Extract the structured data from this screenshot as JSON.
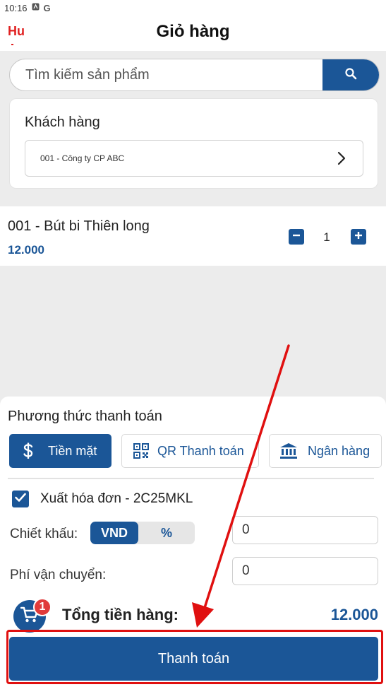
{
  "status_bar": {
    "time": "10:16",
    "icons": [
      "a-icon",
      "google-icon"
    ]
  },
  "header": {
    "back_label": "Hu",
    "title": "Giỏ hàng"
  },
  "search": {
    "placeholder": "Tìm kiếm sản phẩm",
    "icon": "search-icon"
  },
  "customer": {
    "label": "Khách hàng",
    "value": "001 - Công ty CP ABC"
  },
  "cart_items": [
    {
      "name": "001 - Bút bi Thiên long",
      "price": "12.000",
      "quantity": "1"
    }
  ],
  "payment": {
    "title": "Phương thức thanh toán",
    "methods": [
      {
        "label": "Tiền mặt",
        "icon": "dollar-icon",
        "active": true
      },
      {
        "label": "QR Thanh toán",
        "icon": "qr-code-icon",
        "active": false
      },
      {
        "label": "Ngân hàng",
        "icon": "bank-icon",
        "active": false
      }
    ]
  },
  "invoice": {
    "checked": true,
    "label": "Xuất hóa đơn - 2C25MKL"
  },
  "discount": {
    "label": "Chiết khấu:",
    "options": [
      "VND",
      "%"
    ],
    "selected": "VND",
    "value": "0"
  },
  "shipping": {
    "label": "Phí vận chuyển:",
    "value": "0"
  },
  "summary": {
    "cart_count": "1",
    "total_label": "Tổng tiền hàng:",
    "total_value": "12.000"
  },
  "checkout": {
    "label": "Thanh toán"
  },
  "colors": {
    "primary": "#1b5697",
    "back": "#e02020",
    "badge": "#e03b3b",
    "annotation": "#e01010"
  }
}
